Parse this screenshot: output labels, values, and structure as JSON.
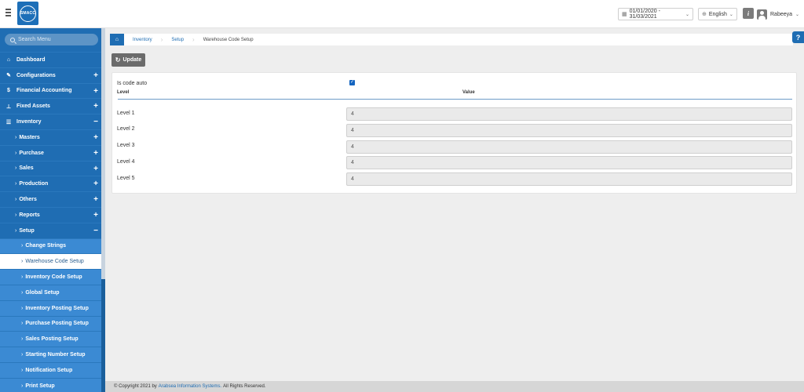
{
  "header": {
    "logo_text": "SMACC",
    "date_range": "01/01/2020 - 31/03/2021",
    "language": "English",
    "info_label": "i",
    "user_name": "Rabeeya"
  },
  "sidebar": {
    "search_placeholder": "Search Menu",
    "items": [
      {
        "label": "Dashboard",
        "icon": "home-icon"
      },
      {
        "label": "Configurations",
        "icon": "wrench-icon",
        "toggle": "+"
      },
      {
        "label": "Financial Accounting",
        "icon": "dollar-icon",
        "toggle": "+"
      },
      {
        "label": "Fixed Assets",
        "icon": "pin-icon",
        "toggle": "+"
      },
      {
        "label": "Inventory",
        "icon": "list-icon",
        "toggle": "−"
      },
      {
        "label": "Masters",
        "toggle": "+"
      },
      {
        "label": "Purchase",
        "toggle": "+"
      },
      {
        "label": "Sales",
        "toggle": "+"
      },
      {
        "label": "Production",
        "toggle": "+"
      },
      {
        "label": "Others",
        "toggle": "+"
      },
      {
        "label": "Reports",
        "toggle": "+"
      },
      {
        "label": "Setup",
        "toggle": "−"
      },
      {
        "label": "Change Strings"
      },
      {
        "label": "Warehouse Code Setup"
      },
      {
        "label": "Inventory Code Setup"
      },
      {
        "label": "Global Setup"
      },
      {
        "label": "Inventory Posting Setup"
      },
      {
        "label": "Purchase Posting Setup"
      },
      {
        "label": "Sales Posting Setup"
      },
      {
        "label": "Starting Number Setup"
      },
      {
        "label": "Notification Setup"
      },
      {
        "label": "Print Setup"
      }
    ]
  },
  "breadcrumb": {
    "items": [
      "Inventory",
      "Setup"
    ],
    "current": "Warehouse Code Setup"
  },
  "help_label": "?",
  "toolbar": {
    "update_label": "Update"
  },
  "form": {
    "code_auto_label": "Is code auto",
    "code_auto_checked": true,
    "col_level": "Level",
    "col_value": "Value",
    "levels": [
      {
        "label": "Level 1",
        "value": "4"
      },
      {
        "label": "Level 2",
        "value": "4"
      },
      {
        "label": "Level 3",
        "value": "4"
      },
      {
        "label": "Level 4",
        "value": "4"
      },
      {
        "label": "Level 5",
        "value": "4"
      }
    ]
  },
  "footer": {
    "prefix": "© Copyright 2021 by",
    "company": "Arabsea Information Systems.",
    "suffix": "All Rights Reserved."
  }
}
